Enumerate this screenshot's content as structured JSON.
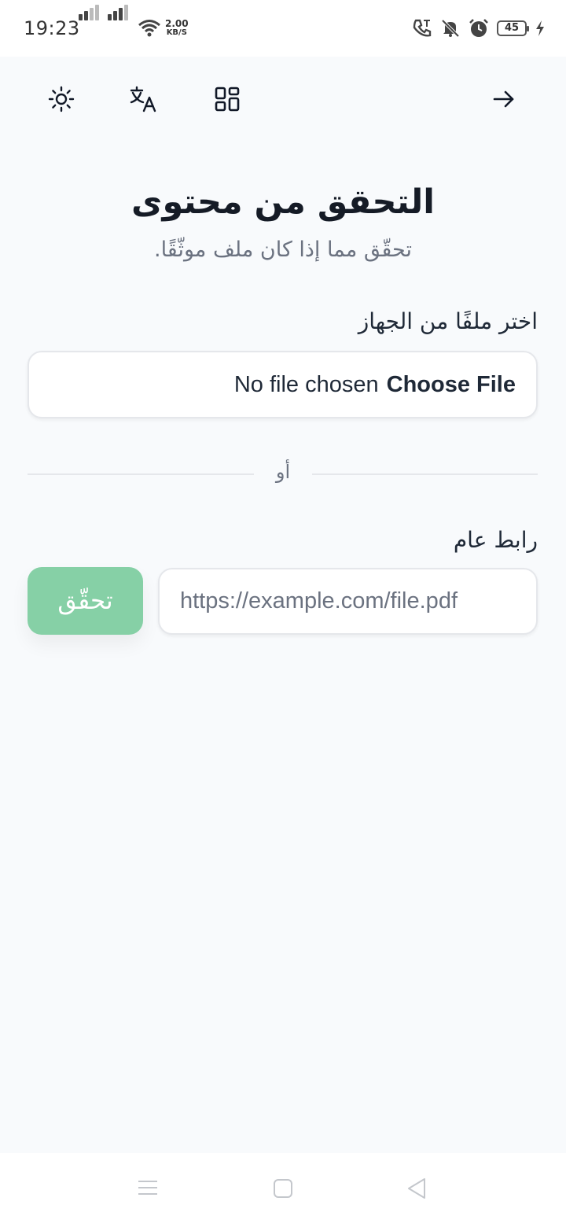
{
  "status_bar": {
    "time": "19:23",
    "net_speed_value": "2.00",
    "net_speed_unit": "KB/S",
    "battery": "45",
    "icons": [
      "signal-icon",
      "wifi-icon",
      "call-icon",
      "mute-icon",
      "alarm-icon",
      "battery-icon",
      "charging-icon"
    ]
  },
  "header": {
    "icons": [
      "theme-toggle-icon",
      "translate-icon",
      "apps-grid-icon",
      "arrow-right-icon"
    ]
  },
  "page": {
    "title": "التحقق من محتوى",
    "subtitle": "تحقّق مما إذا كان ملف موثّقًا."
  },
  "file_section": {
    "label": "اختر ملفًا من الجهاز",
    "choose_label": "Choose File",
    "no_file_text": "No file chosen"
  },
  "divider": {
    "text": "أو"
  },
  "url_section": {
    "label": "رابط عام",
    "placeholder": "https://example.com/file.pdf",
    "button_label": "تحقّق"
  },
  "colors": {
    "background": "#f8fafc",
    "accent_button": "#86d0a6",
    "text_primary": "#151b26",
    "text_muted": "#6b7280"
  }
}
